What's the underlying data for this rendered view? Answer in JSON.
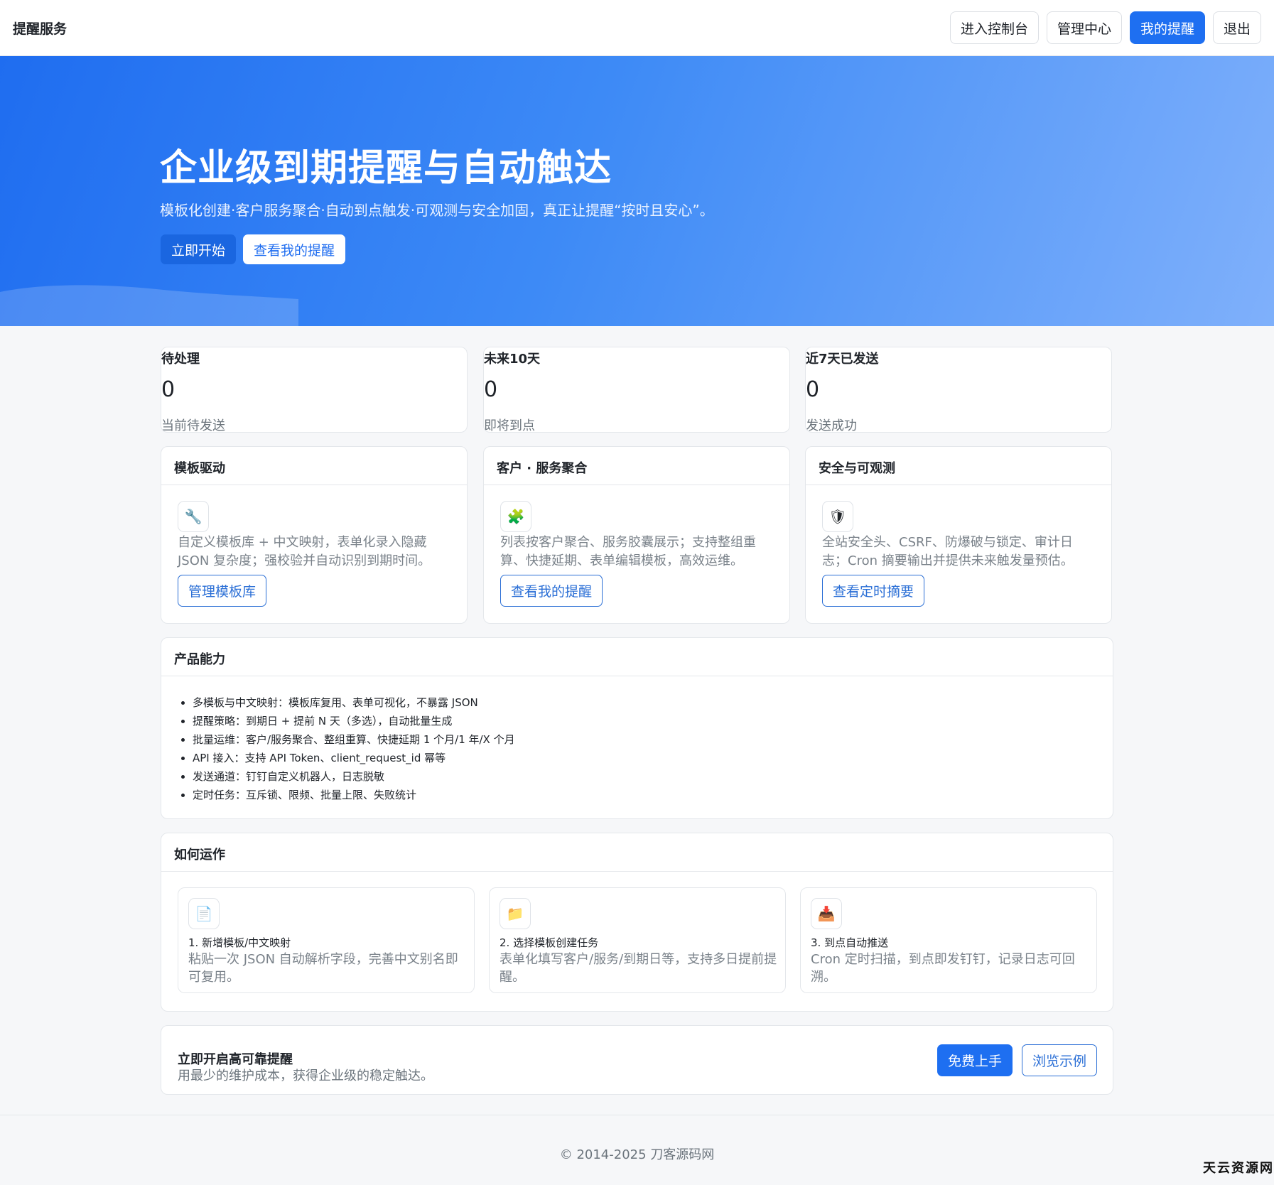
{
  "brand": "提醒服务",
  "nav": [
    {
      "label": "进入控制台",
      "active": false
    },
    {
      "label": "管理中心",
      "active": false
    },
    {
      "label": "我的提醒",
      "active": true
    },
    {
      "label": "退出",
      "active": false
    }
  ],
  "hero": {
    "title": "企业级到期提醒与自动触达",
    "subtitle": "模板化创建·客户服务聚合·自动到点触发·可观测与安全加固，真正让提醒“按时且安心”。",
    "primary_button": "立即开始",
    "secondary_button": "查看我的提醒"
  },
  "stats": [
    {
      "label": "待处理",
      "value": "0",
      "note": "当前待发送"
    },
    {
      "label": "未来10天",
      "value": "0",
      "note": "即将到点"
    },
    {
      "label": "近7天已发送",
      "value": "0",
      "note": "发送成功"
    }
  ],
  "features": [
    {
      "title": "模板驱动",
      "icon": "wrench-icon",
      "glyph": "🔧",
      "text": "自定义模板库 + 中文映射，表单化录入隐藏 JSON 复杂度；强校验并自动识别到期时间。",
      "button": "管理模板库"
    },
    {
      "title": "客户 · 服务聚合",
      "icon": "puzzle-icon",
      "glyph": "🧩",
      "text": "列表按客户聚合、服务胶囊展示；支持整组重算、快捷延期、表单编辑模板，高效运维。",
      "button": "查看我的提醒"
    },
    {
      "title": "安全与可观测",
      "icon": "shield-icon",
      "glyph": "🛡",
      "text": "全站安全头、CSRF、防爆破与锁定、审计日志；Cron 摘要输出并提供未来触发量预估。",
      "button": "查看定时摘要"
    }
  ],
  "capabilities": {
    "title": "产品能力",
    "items": [
      "多模板与中文映射：模板库复用、表单可视化，不暴露 JSON",
      "提醒策略：到期日 + 提前 N 天（多选），自动批量生成",
      "批量运维：客户/服务聚合、整组重算、快捷延期 1 个月/1 年/X 个月",
      "API 接入：支持 API Token、client_request_id 幂等",
      "发送通道：钉钉自定义机器人，日志脱敏",
      "定时任务：互斥锁、限频、批量上限、失败统计"
    ]
  },
  "how": {
    "title": "如何运作",
    "steps": [
      {
        "icon": "document-icon",
        "glyph": "📄",
        "title": "1. 新增模板/中文映射",
        "text": "粘贴一次 JSON 自动解析字段，完善中文别名即可复用。"
      },
      {
        "icon": "folder-icon",
        "glyph": "📁",
        "title": "2. 选择模板创建任务",
        "text": "表单化填写客户/服务/到期日等，支持多日提前提醒。"
      },
      {
        "icon": "inbox-tray-icon",
        "glyph": "📥",
        "title": "3. 到点自动推送",
        "text": "Cron 定时扫描，到点即发钉钉，记录日志可回溯。"
      }
    ]
  },
  "cta": {
    "title": "立即开启高可靠提醒",
    "subtitle": "用最少的维护成本，获得企业级的稳定触达。",
    "primary_button": "免费上手",
    "secondary_button": "浏览示例"
  },
  "footer": "© 2014-2025 刀客源码网",
  "watermark": "天云资源网",
  "colors": {
    "accent": "#1e6ff1",
    "hero_start": "#1f6df0",
    "hero_end": "#7fb0fb",
    "outline": "#2b6fd6"
  }
}
